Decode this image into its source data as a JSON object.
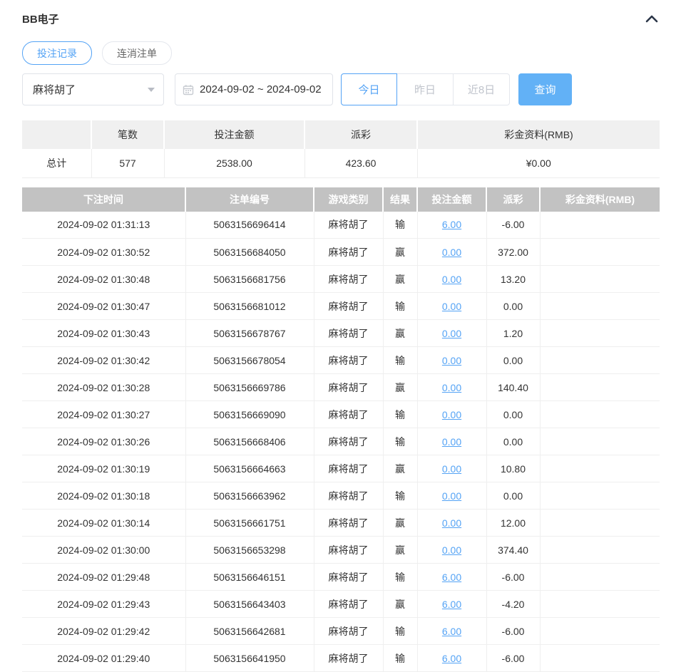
{
  "panel": {
    "title": "BB电子",
    "collapse_icon": "chevron-up-icon"
  },
  "tabs": [
    {
      "label": "投注记录",
      "active": true
    },
    {
      "label": "连消注单",
      "active": false
    }
  ],
  "filters": {
    "game_select": {
      "value": "麻将胡了",
      "icon": "caret-down-icon"
    },
    "date_range": {
      "value": "2024-09-02 ~ 2024-09-02",
      "icon": "calendar-icon"
    },
    "quick_buttons": [
      {
        "label": "今日",
        "active": true
      },
      {
        "label": "昨日",
        "active": false
      },
      {
        "label": "近8日",
        "active": false
      }
    ],
    "search_label": "查询"
  },
  "summary": {
    "headers": [
      "",
      "笔数",
      "投注金额",
      "派彩",
      "彩金资料(RMB)"
    ],
    "row": {
      "label": "总计",
      "count": "577",
      "bet_amount": "2538.00",
      "payout": "423.60",
      "bonus": "¥0.00"
    }
  },
  "records": {
    "headers": [
      "下注时间",
      "注单编号",
      "游戏类别",
      "结果",
      "投注金额",
      "派彩",
      "彩金资料(RMB)"
    ],
    "rows": [
      {
        "time": "2024-09-02 01:31:13",
        "order_id": "5063156696414",
        "game": "麻将胡了",
        "result": "输",
        "bet": "6.00",
        "payout": "-6.00",
        "bonus": ""
      },
      {
        "time": "2024-09-02 01:30:52",
        "order_id": "5063156684050",
        "game": "麻将胡了",
        "result": "赢",
        "bet": "0.00",
        "payout": "372.00",
        "bonus": ""
      },
      {
        "time": "2024-09-02 01:30:48",
        "order_id": "5063156681756",
        "game": "麻将胡了",
        "result": "赢",
        "bet": "0.00",
        "payout": "13.20",
        "bonus": ""
      },
      {
        "time": "2024-09-02 01:30:47",
        "order_id": "5063156681012",
        "game": "麻将胡了",
        "result": "输",
        "bet": "0.00",
        "payout": "0.00",
        "bonus": ""
      },
      {
        "time": "2024-09-02 01:30:43",
        "order_id": "5063156678767",
        "game": "麻将胡了",
        "result": "赢",
        "bet": "0.00",
        "payout": "1.20",
        "bonus": ""
      },
      {
        "time": "2024-09-02 01:30:42",
        "order_id": "5063156678054",
        "game": "麻将胡了",
        "result": "输",
        "bet": "0.00",
        "payout": "0.00",
        "bonus": ""
      },
      {
        "time": "2024-09-02 01:30:28",
        "order_id": "5063156669786",
        "game": "麻将胡了",
        "result": "赢",
        "bet": "0.00",
        "payout": "140.40",
        "bonus": ""
      },
      {
        "time": "2024-09-02 01:30:27",
        "order_id": "5063156669090",
        "game": "麻将胡了",
        "result": "输",
        "bet": "0.00",
        "payout": "0.00",
        "bonus": ""
      },
      {
        "time": "2024-09-02 01:30:26",
        "order_id": "5063156668406",
        "game": "麻将胡了",
        "result": "输",
        "bet": "0.00",
        "payout": "0.00",
        "bonus": ""
      },
      {
        "time": "2024-09-02 01:30:19",
        "order_id": "5063156664663",
        "game": "麻将胡了",
        "result": "赢",
        "bet": "0.00",
        "payout": "10.80",
        "bonus": ""
      },
      {
        "time": "2024-09-02 01:30:18",
        "order_id": "5063156663962",
        "game": "麻将胡了",
        "result": "输",
        "bet": "0.00",
        "payout": "0.00",
        "bonus": ""
      },
      {
        "time": "2024-09-02 01:30:14",
        "order_id": "5063156661751",
        "game": "麻将胡了",
        "result": "赢",
        "bet": "0.00",
        "payout": "12.00",
        "bonus": ""
      },
      {
        "time": "2024-09-02 01:30:00",
        "order_id": "5063156653298",
        "game": "麻将胡了",
        "result": "赢",
        "bet": "0.00",
        "payout": "374.40",
        "bonus": ""
      },
      {
        "time": "2024-09-02 01:29:48",
        "order_id": "5063156646151",
        "game": "麻将胡了",
        "result": "输",
        "bet": "6.00",
        "payout": "-6.00",
        "bonus": ""
      },
      {
        "time": "2024-09-02 01:29:43",
        "order_id": "5063156643403",
        "game": "麻将胡了",
        "result": "赢",
        "bet": "6.00",
        "payout": "-4.20",
        "bonus": ""
      },
      {
        "time": "2024-09-02 01:29:42",
        "order_id": "5063156642681",
        "game": "麻将胡了",
        "result": "输",
        "bet": "6.00",
        "payout": "-6.00",
        "bonus": ""
      },
      {
        "time": "2024-09-02 01:29:40",
        "order_id": "5063156641950",
        "game": "麻将胡了",
        "result": "输",
        "bet": "6.00",
        "payout": "-6.00",
        "bonus": ""
      }
    ]
  },
  "colors": {
    "accent_blue": "#54a3f5",
    "search_button_blue": "#62b1f6",
    "negative_red": "#ef5a5a",
    "table_header_gray": "#c2c2c2",
    "summary_header_gray": "#f0f0f0"
  }
}
